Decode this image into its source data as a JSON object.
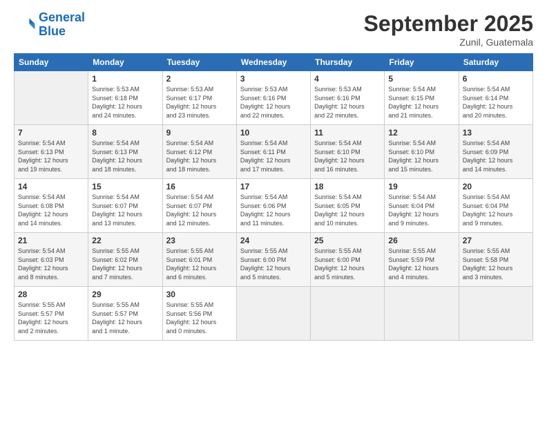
{
  "header": {
    "logo_line1": "General",
    "logo_line2": "Blue",
    "month_title": "September 2025",
    "subtitle": "Zunil, Guatemala"
  },
  "days_of_week": [
    "Sunday",
    "Monday",
    "Tuesday",
    "Wednesday",
    "Thursday",
    "Friday",
    "Saturday"
  ],
  "weeks": [
    [
      {
        "day": "",
        "info": ""
      },
      {
        "day": "1",
        "info": "Sunrise: 5:53 AM\nSunset: 6:18 PM\nDaylight: 12 hours\nand 24 minutes."
      },
      {
        "day": "2",
        "info": "Sunrise: 5:53 AM\nSunset: 6:17 PM\nDaylight: 12 hours\nand 23 minutes."
      },
      {
        "day": "3",
        "info": "Sunrise: 5:53 AM\nSunset: 6:16 PM\nDaylight: 12 hours\nand 22 minutes."
      },
      {
        "day": "4",
        "info": "Sunrise: 5:53 AM\nSunset: 6:16 PM\nDaylight: 12 hours\nand 22 minutes."
      },
      {
        "day": "5",
        "info": "Sunrise: 5:54 AM\nSunset: 6:15 PM\nDaylight: 12 hours\nand 21 minutes."
      },
      {
        "day": "6",
        "info": "Sunrise: 5:54 AM\nSunset: 6:14 PM\nDaylight: 12 hours\nand 20 minutes."
      }
    ],
    [
      {
        "day": "7",
        "info": "Sunrise: 5:54 AM\nSunset: 6:13 PM\nDaylight: 12 hours\nand 19 minutes."
      },
      {
        "day": "8",
        "info": "Sunrise: 5:54 AM\nSunset: 6:13 PM\nDaylight: 12 hours\nand 18 minutes."
      },
      {
        "day": "9",
        "info": "Sunrise: 5:54 AM\nSunset: 6:12 PM\nDaylight: 12 hours\nand 18 minutes."
      },
      {
        "day": "10",
        "info": "Sunrise: 5:54 AM\nSunset: 6:11 PM\nDaylight: 12 hours\nand 17 minutes."
      },
      {
        "day": "11",
        "info": "Sunrise: 5:54 AM\nSunset: 6:10 PM\nDaylight: 12 hours\nand 16 minutes."
      },
      {
        "day": "12",
        "info": "Sunrise: 5:54 AM\nSunset: 6:10 PM\nDaylight: 12 hours\nand 15 minutes."
      },
      {
        "day": "13",
        "info": "Sunrise: 5:54 AM\nSunset: 6:09 PM\nDaylight: 12 hours\nand 14 minutes."
      }
    ],
    [
      {
        "day": "14",
        "info": "Sunrise: 5:54 AM\nSunset: 6:08 PM\nDaylight: 12 hours\nand 14 minutes."
      },
      {
        "day": "15",
        "info": "Sunrise: 5:54 AM\nSunset: 6:07 PM\nDaylight: 12 hours\nand 13 minutes."
      },
      {
        "day": "16",
        "info": "Sunrise: 5:54 AM\nSunset: 6:07 PM\nDaylight: 12 hours\nand 12 minutes."
      },
      {
        "day": "17",
        "info": "Sunrise: 5:54 AM\nSunset: 6:06 PM\nDaylight: 12 hours\nand 11 minutes."
      },
      {
        "day": "18",
        "info": "Sunrise: 5:54 AM\nSunset: 6:05 PM\nDaylight: 12 hours\nand 10 minutes."
      },
      {
        "day": "19",
        "info": "Sunrise: 5:54 AM\nSunset: 6:04 PM\nDaylight: 12 hours\nand 9 minutes."
      },
      {
        "day": "20",
        "info": "Sunrise: 5:54 AM\nSunset: 6:04 PM\nDaylight: 12 hours\nand 9 minutes."
      }
    ],
    [
      {
        "day": "21",
        "info": "Sunrise: 5:54 AM\nSunset: 6:03 PM\nDaylight: 12 hours\nand 8 minutes."
      },
      {
        "day": "22",
        "info": "Sunrise: 5:55 AM\nSunset: 6:02 PM\nDaylight: 12 hours\nand 7 minutes."
      },
      {
        "day": "23",
        "info": "Sunrise: 5:55 AM\nSunset: 6:01 PM\nDaylight: 12 hours\nand 6 minutes."
      },
      {
        "day": "24",
        "info": "Sunrise: 5:55 AM\nSunset: 6:00 PM\nDaylight: 12 hours\nand 5 minutes."
      },
      {
        "day": "25",
        "info": "Sunrise: 5:55 AM\nSunset: 6:00 PM\nDaylight: 12 hours\nand 5 minutes."
      },
      {
        "day": "26",
        "info": "Sunrise: 5:55 AM\nSunset: 5:59 PM\nDaylight: 12 hours\nand 4 minutes."
      },
      {
        "day": "27",
        "info": "Sunrise: 5:55 AM\nSunset: 5:58 PM\nDaylight: 12 hours\nand 3 minutes."
      }
    ],
    [
      {
        "day": "28",
        "info": "Sunrise: 5:55 AM\nSunset: 5:57 PM\nDaylight: 12 hours\nand 2 minutes."
      },
      {
        "day": "29",
        "info": "Sunrise: 5:55 AM\nSunset: 5:57 PM\nDaylight: 12 hours\nand 1 minute."
      },
      {
        "day": "30",
        "info": "Sunrise: 5:55 AM\nSunset: 5:56 PM\nDaylight: 12 hours\nand 0 minutes."
      },
      {
        "day": "",
        "info": ""
      },
      {
        "day": "",
        "info": ""
      },
      {
        "day": "",
        "info": ""
      },
      {
        "day": "",
        "info": ""
      }
    ]
  ]
}
